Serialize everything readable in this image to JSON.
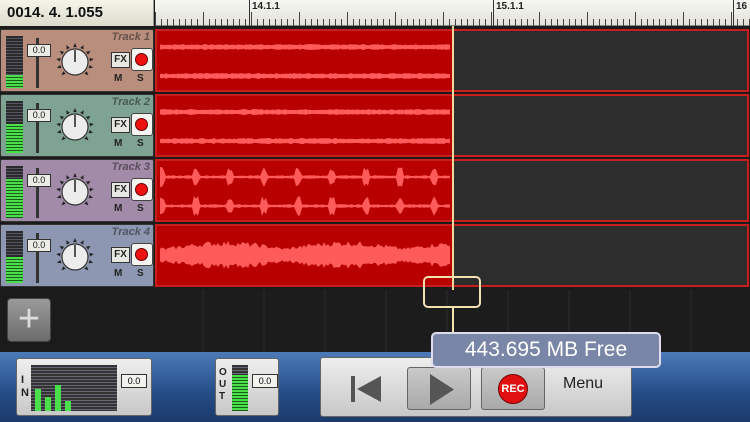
{
  "position": "0014.  4.  1.055",
  "ruler": {
    "markers": [
      "14.1.1",
      "15.1.1",
      "16"
    ]
  },
  "tracks": [
    {
      "name": "Track 1",
      "volume": "0.0",
      "fx": "FX",
      "mute": "M",
      "solo": "S",
      "meter_level": 0.25,
      "color": "#b98e7c",
      "wave": "dense"
    },
    {
      "name": "Track 2",
      "volume": "0.0",
      "fx": "FX",
      "mute": "M",
      "solo": "S",
      "meter_level": 0.55,
      "color": "#7ea392",
      "wave": "dense"
    },
    {
      "name": "Track 3",
      "volume": "0.0",
      "fx": "FX",
      "mute": "M",
      "solo": "S",
      "meter_level": 0.75,
      "color": "#a28aa9",
      "wave": "spiky"
    },
    {
      "name": "Track 4",
      "volume": "0.0",
      "fx": "FX",
      "mute": "M",
      "solo": "S",
      "meter_level": 0.5,
      "color": "#8d97b2",
      "wave": "big"
    }
  ],
  "add_track_icon": "plus-icon",
  "free_space": "443.695 MB Free",
  "io": {
    "in_label": "IN",
    "in_volume": "0.0",
    "out_label": "OUT",
    "out_volume": "0.0"
  },
  "transport": {
    "rewind_icon": "rewind-to-start-icon",
    "play_icon": "play-icon",
    "rec_label": "REC",
    "menu_label": "Menu"
  }
}
